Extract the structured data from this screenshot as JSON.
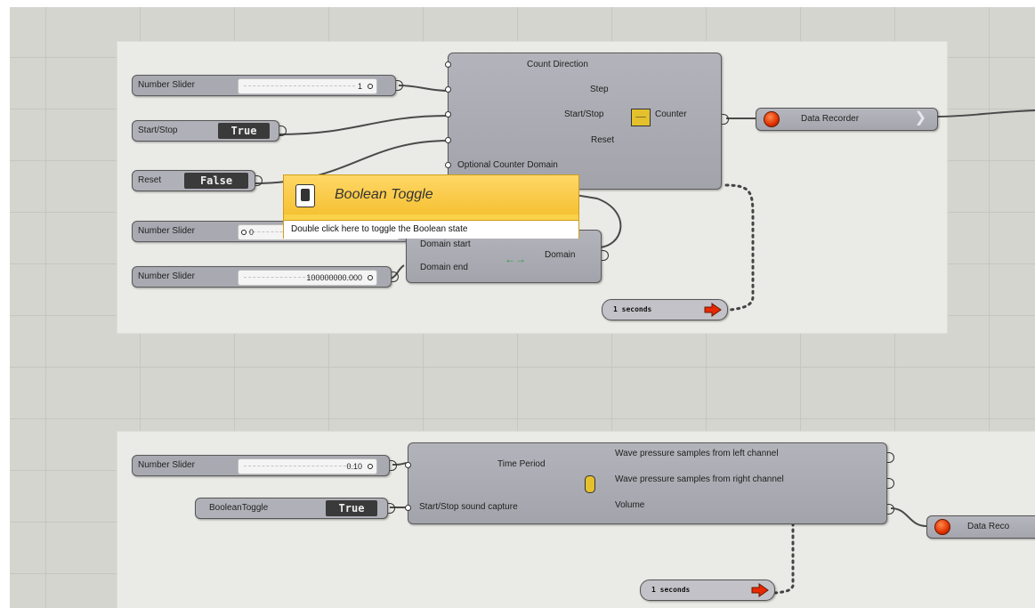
{
  "group1": {
    "slider_count": {
      "label": "Number Slider",
      "value": "1"
    },
    "toggle_start": {
      "label": "Start/Stop",
      "state": "True"
    },
    "toggle_reset": {
      "label": "Reset",
      "state": "False"
    },
    "slider_domain_start": {
      "label": "Number Slider",
      "value": "0"
    },
    "slider_domain_end": {
      "label": "Number Slider",
      "value": "100000000.000"
    },
    "counter": {
      "inputs": [
        "Count Direction",
        "Step",
        "Start/Stop",
        "Reset",
        "Optional Counter Domain"
      ],
      "output": "Counter"
    },
    "domain": {
      "inputs": [
        "Domain start",
        "Domain end"
      ],
      "output": "Domain"
    },
    "recorder": {
      "label": "Data Recorder"
    },
    "timer": {
      "label": "1 seconds"
    }
  },
  "tooltip": {
    "title": "Boolean Toggle",
    "description": "Double click here to toggle the Boolean state",
    "icon": "boolean-toggle-icon"
  },
  "group2": {
    "slider_period": {
      "label": "Number Slider",
      "value": "0.10"
    },
    "toggle": {
      "label": "BooleanToggle",
      "state": "True"
    },
    "capture": {
      "inputs": [
        "Time Period",
        "Start/Stop sound capture"
      ],
      "outputs": [
        "Wave pressure samples from left channel",
        "Wave pressure samples from right channel",
        "Volume"
      ]
    },
    "recorder": {
      "label": "Data Reco"
    },
    "timer": {
      "label": "1 seconds"
    }
  },
  "colors": {
    "canvas": "#d5d5d0",
    "group": "#eaeae6",
    "component": "#a9a9b1",
    "tooltip": "#f9d24a",
    "record": "#e03000",
    "timer_arrow": "#e82800"
  }
}
